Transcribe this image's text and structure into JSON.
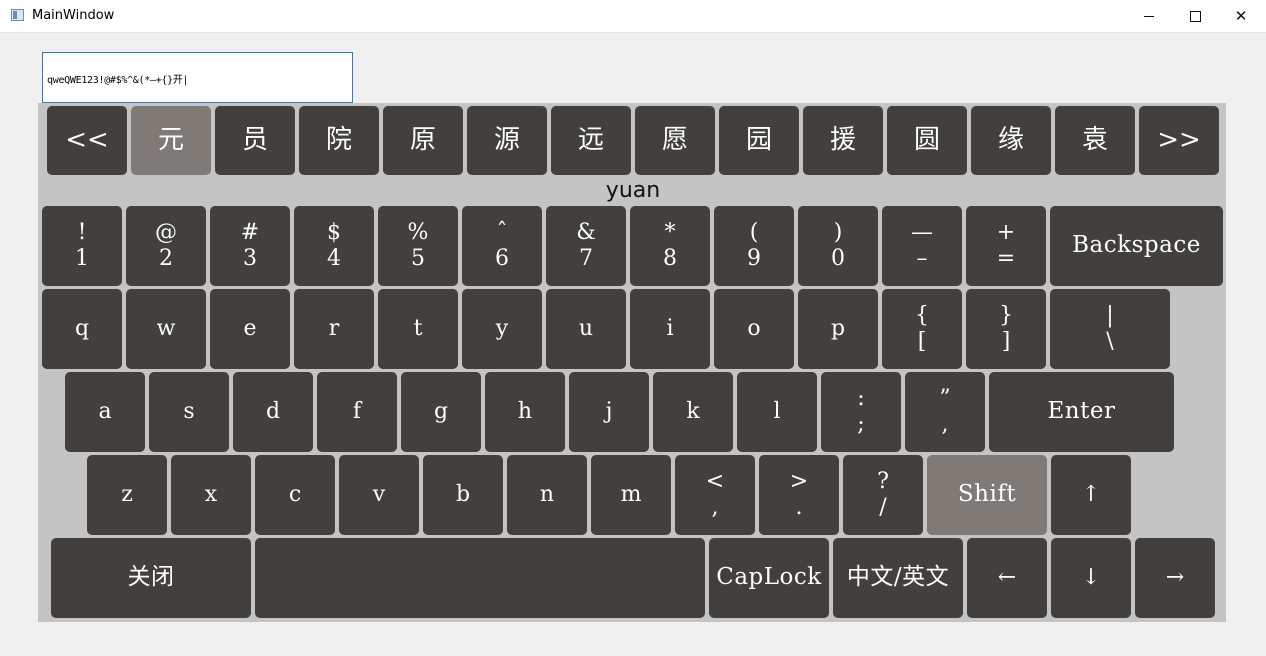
{
  "window": {
    "title": "MainWindow",
    "minimize": "",
    "maximize": "",
    "close": "✕"
  },
  "input": {
    "value": "qweQWE123!@#$%^&(*—+{}开|"
  },
  "keyboard": {
    "pinyin": "yuan",
    "candidate_prev": "<<",
    "candidate_next": ">>",
    "candidates": [
      "元",
      "员",
      "院",
      "原",
      "源",
      "远",
      "愿",
      "园",
      "援",
      "圆",
      "缘",
      "袁"
    ],
    "number_row": [
      {
        "top": "!",
        "bottom": "1"
      },
      {
        "top": "@",
        "bottom": "2"
      },
      {
        "top": "#",
        "bottom": "3"
      },
      {
        "top": "$",
        "bottom": "4"
      },
      {
        "top": "%",
        "bottom": "5"
      },
      {
        "top": "ˆ",
        "bottom": "6"
      },
      {
        "top": "&",
        "bottom": "7"
      },
      {
        "top": "*",
        "bottom": "8"
      },
      {
        "top": "(",
        "bottom": "9"
      },
      {
        "top": ")",
        "bottom": "0"
      },
      {
        "top": "—",
        "bottom": "–"
      },
      {
        "top": "+",
        "bottom": "="
      }
    ],
    "backspace": "Backspace",
    "qwerty_row": [
      "q",
      "w",
      "e",
      "r",
      "t",
      "y",
      "u",
      "i",
      "o",
      "p"
    ],
    "brackets": [
      {
        "top": "{",
        "bottom": "["
      },
      {
        "top": "}",
        "bottom": "]"
      },
      {
        "top": "|",
        "bottom": "\\"
      }
    ],
    "home_row": [
      "a",
      "s",
      "d",
      "f",
      "g",
      "h",
      "j",
      "k",
      "l"
    ],
    "home_punct": [
      {
        "top": ":",
        "bottom": ";"
      },
      {
        "top": "”",
        "bottom": ","
      }
    ],
    "enter": "Enter",
    "bottom_row": [
      "z",
      "x",
      "c",
      "v",
      "b",
      "n",
      "m"
    ],
    "bottom_punct": [
      {
        "top": "<",
        "bottom": ","
      },
      {
        "top": ">",
        "bottom": "."
      },
      {
        "top": "?",
        "bottom": "/"
      }
    ],
    "shift": "Shift",
    "up": "↑",
    "close": "关闭",
    "space": "",
    "caplock": "CapLock",
    "lang": "中文/英文",
    "left": "←",
    "down": "↓",
    "right": "→"
  },
  "colors": {
    "key": "#433f3c",
    "key_selected": "#7f7a76",
    "panel": "#c4c4c4"
  }
}
